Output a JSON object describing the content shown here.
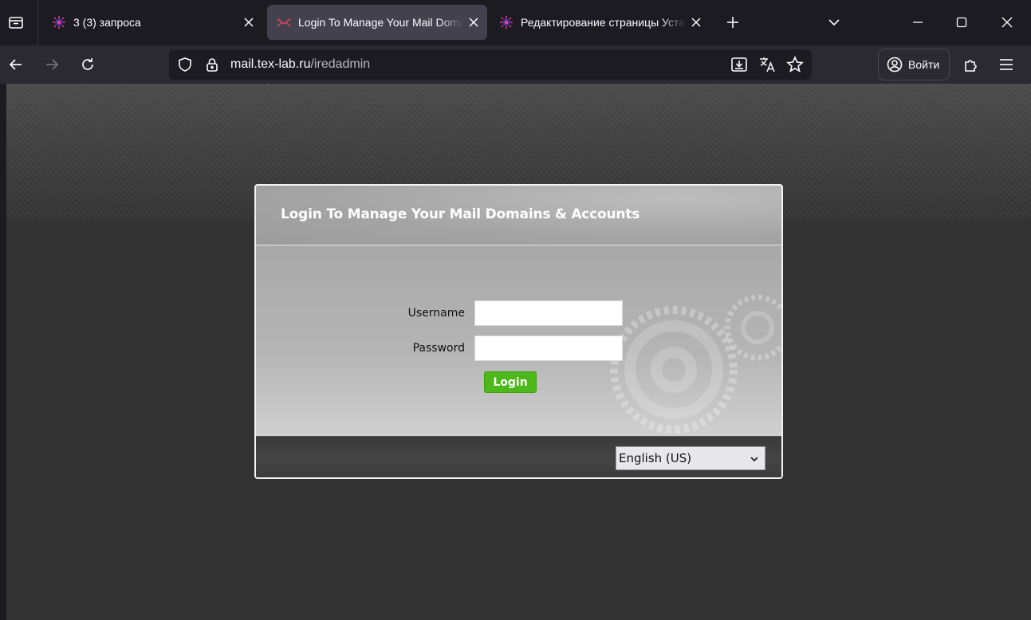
{
  "browser": {
    "tabs": [
      {
        "title": "3 (3) запроса",
        "active": false,
        "favicon": "colorful-bug-icon"
      },
      {
        "title": "Login To Manage Your Mail Domains & Accounts",
        "active": true,
        "favicon": "iredmail-envelope-icon"
      },
      {
        "title": "Редактирование страницы Установка",
        "active": false,
        "favicon": "colorful-bug-icon"
      }
    ],
    "url_host": "mail.tex-lab.ru",
    "url_path": "/iredadmin",
    "signin_label": "Войти",
    "accent_color": "#42414d"
  },
  "page": {
    "title": "Login To Manage Your Mail Domains & Accounts",
    "username_label": "Username",
    "password_label": "Password",
    "username_value": "",
    "password_value": "",
    "login_button": "Login",
    "language_selected": "English (US)",
    "login_button_color": "#4db81a"
  }
}
